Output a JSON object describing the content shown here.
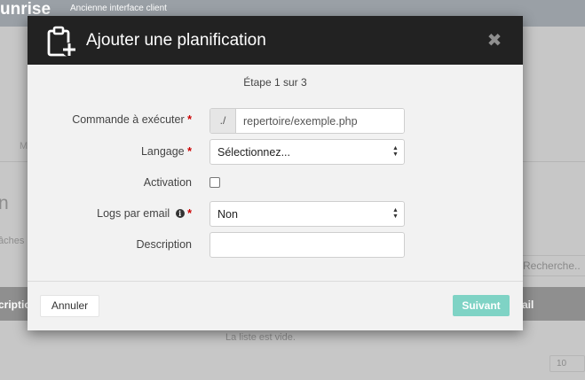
{
  "background": {
    "brand": "unrise",
    "subtitle": "Ancienne interface client",
    "menu_fragment": "M",
    "heading_fragment": "n",
    "tasks_fragment": "tâches",
    "search_placeholder": "Recherche..",
    "column_left": "cription",
    "column_right": "ail",
    "empty_text": "La liste est vide.",
    "page_size": "10"
  },
  "modal": {
    "title": "Ajouter une planification",
    "close_icon": "close-icon",
    "header_icon": "clipboard-add-icon",
    "step": "Étape 1 sur 3",
    "fields": {
      "command": {
        "label": "Commande à exécuter",
        "required_mark": "*",
        "prefix": "./",
        "value": "repertoire/exemple.php"
      },
      "language": {
        "label": "Langage",
        "required_mark": "*",
        "value": "Sélectionnez..."
      },
      "activation": {
        "label": "Activation",
        "checked": false
      },
      "email_logs": {
        "label": "Logs par email",
        "info_icon": "info-icon",
        "required_mark": "*",
        "value": "Non"
      },
      "description": {
        "label": "Description",
        "value": ""
      }
    },
    "footer": {
      "cancel_label": "Annuler",
      "next_label": "Suivant"
    }
  },
  "colors": {
    "header_bg": "#222222",
    "next_button": "#7fd3c5",
    "required": "#cc0000",
    "overlay_gray": "#c7c7c7"
  }
}
